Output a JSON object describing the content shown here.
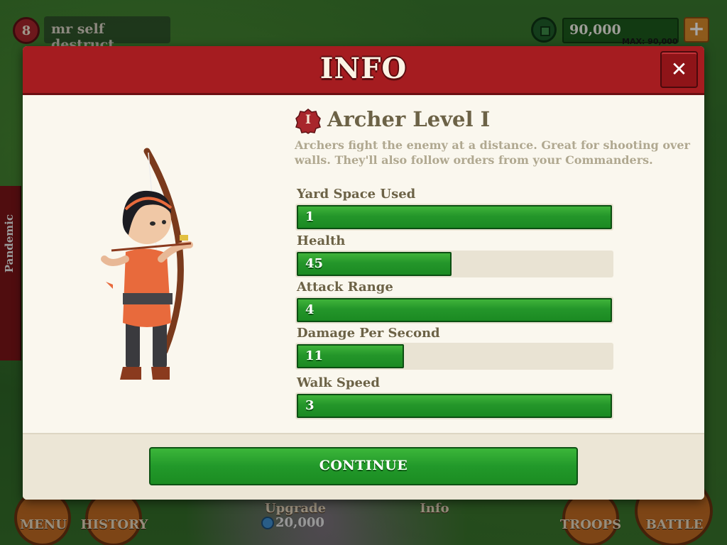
{
  "hud": {
    "player_level": "8",
    "player_name": "mr self destruct",
    "resource_amount": "90,000",
    "resource_max": "MAX: 90,000",
    "plus": "+"
  },
  "side_tab": {
    "label": "Pandemic"
  },
  "bottom_bar": {
    "menu": "MENU",
    "history": "HISTORY",
    "upgrade": "Upgrade",
    "upgrade_cost": "20,000",
    "info": "Info",
    "troops": "TROOPS",
    "battle": "BATTLE"
  },
  "modal": {
    "title": "INFO",
    "close": "✕",
    "unit": {
      "level_badge": "I",
      "title": "Archer Level I",
      "description": "Archers fight the enemy at a distance. Great for shooting over walls. They'll also follow orders from your Commanders."
    },
    "stats": [
      {
        "label": "Yard Space Used",
        "value": "1",
        "fill": 1.0
      },
      {
        "label": "Health",
        "value": "45",
        "fill": 0.49
      },
      {
        "label": "Attack Range",
        "value": "4",
        "fill": 1.0
      },
      {
        "label": "Damage Per Second",
        "value": "11",
        "fill": 0.34
      },
      {
        "label": "Walk Speed",
        "value": "3",
        "fill": 1.0
      }
    ],
    "continue_label": "CONTINUE"
  },
  "colors": {
    "header_red": "#a51c20",
    "panel_cream": "#faf7ee",
    "bar_green": "#24962a",
    "text_brown": "#6c6246"
  }
}
